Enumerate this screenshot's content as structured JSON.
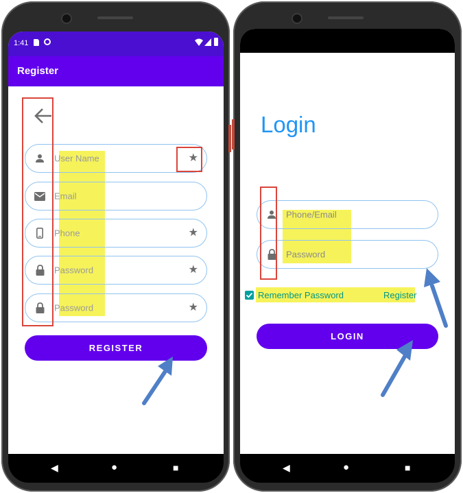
{
  "colors": {
    "primary": "#6200ee",
    "status_bar": "#4b0fd1",
    "field_border": "#8fc3f0",
    "highlight": "#f6f35a",
    "annotation_red": "#d9453b",
    "annotation_arrow": "#4f7fc7",
    "login_title": "#2196f3",
    "link": "#009688"
  },
  "register_screen": {
    "status": {
      "time": "1:41"
    },
    "appbar": {
      "title": "Register"
    },
    "back_icon": "arrow-back-icon",
    "fields": [
      {
        "icon": "person-icon",
        "placeholder": "User Name",
        "required": true
      },
      {
        "icon": "mail-icon",
        "placeholder": "Email",
        "required": false
      },
      {
        "icon": "phone-icon",
        "placeholder": "Phone",
        "required": true
      },
      {
        "icon": "lock-icon",
        "placeholder": "Password",
        "required": true
      },
      {
        "icon": "lock-icon",
        "placeholder": "Password",
        "required": true
      }
    ],
    "register_button": "REGISTER"
  },
  "login_screen": {
    "title": "Login",
    "fields": [
      {
        "icon": "person-icon",
        "placeholder": "Phone/Email"
      },
      {
        "icon": "lock-icon",
        "placeholder": "Password"
      }
    ],
    "remember_label": "Remember Password",
    "remember_checked": true,
    "register_link": "Register",
    "login_button": "LOGIN"
  }
}
